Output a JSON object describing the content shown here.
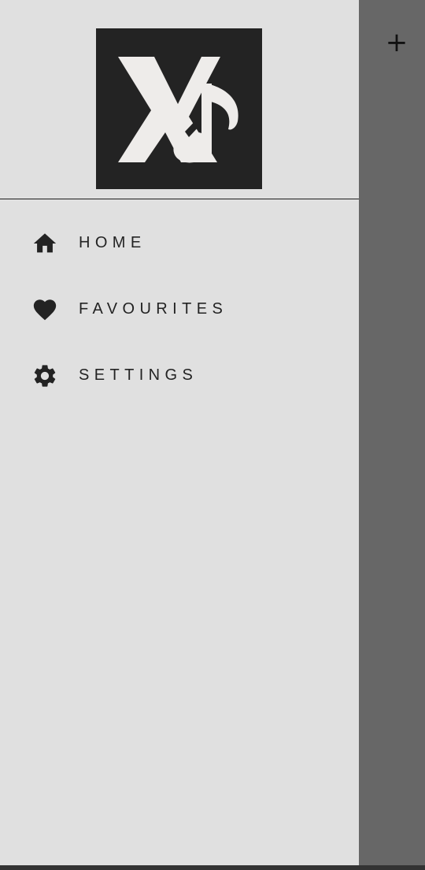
{
  "drawer": {
    "logo_icon": "xs-music-note-logo",
    "items": [
      {
        "icon": "home-icon",
        "label": "HOME"
      },
      {
        "icon": "heart-icon",
        "label": "FAVOURITES"
      },
      {
        "icon": "gear-icon",
        "label": "SETTINGS"
      }
    ]
  },
  "scrim": {
    "add_label": "+"
  },
  "colors": {
    "drawer_bg": "#e0e0e0",
    "scrim_bg": "#676767",
    "logo_bg": "#232323",
    "logo_fg": "#eeecea",
    "text": "#232323"
  }
}
